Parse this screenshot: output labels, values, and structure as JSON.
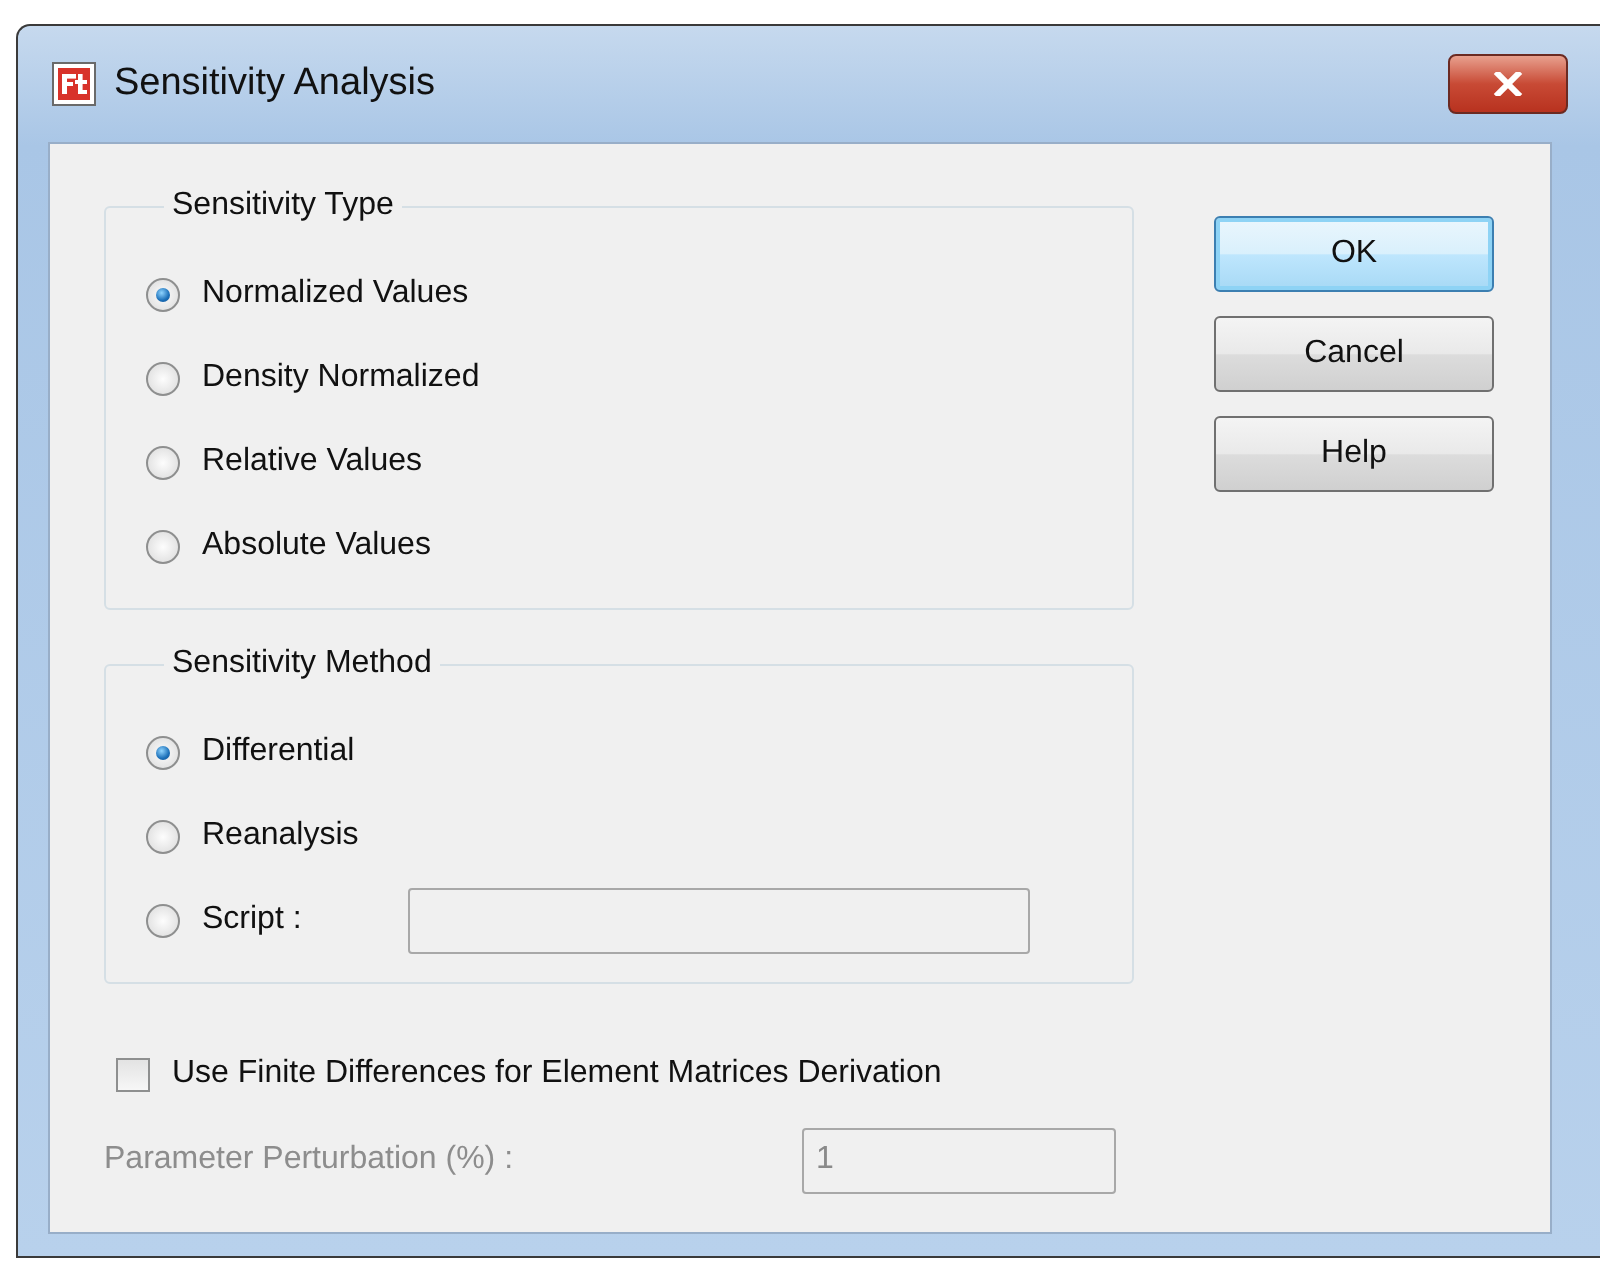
{
  "window": {
    "title": "Sensitivity Analysis"
  },
  "groups": [
    {
      "title": "Sensitivity Type",
      "options": [
        {
          "label": "Normalized Values",
          "selected": true
        },
        {
          "label": "Density Normalized",
          "selected": false
        },
        {
          "label": "Relative Values",
          "selected": false
        },
        {
          "label": "Absolute Values",
          "selected": false
        }
      ]
    },
    {
      "title": "Sensitivity Method",
      "options": [
        {
          "label": "Differential",
          "selected": true
        },
        {
          "label": "Reanalysis",
          "selected": false
        },
        {
          "label": "Script :",
          "selected": false,
          "field": {
            "disabled": true
          }
        }
      ]
    }
  ],
  "buttons": [
    {
      "label": "OK",
      "default": true
    },
    {
      "label": "Cancel",
      "default": false
    },
    {
      "label": "Help",
      "default": false
    }
  ],
  "finite_differences": {
    "label": "Use Finite Differences for Element Matrices Derivation",
    "checked": false
  },
  "perturbation": {
    "label": "Parameter Perturbation (%) :",
    "value": "1",
    "disabled": true
  }
}
